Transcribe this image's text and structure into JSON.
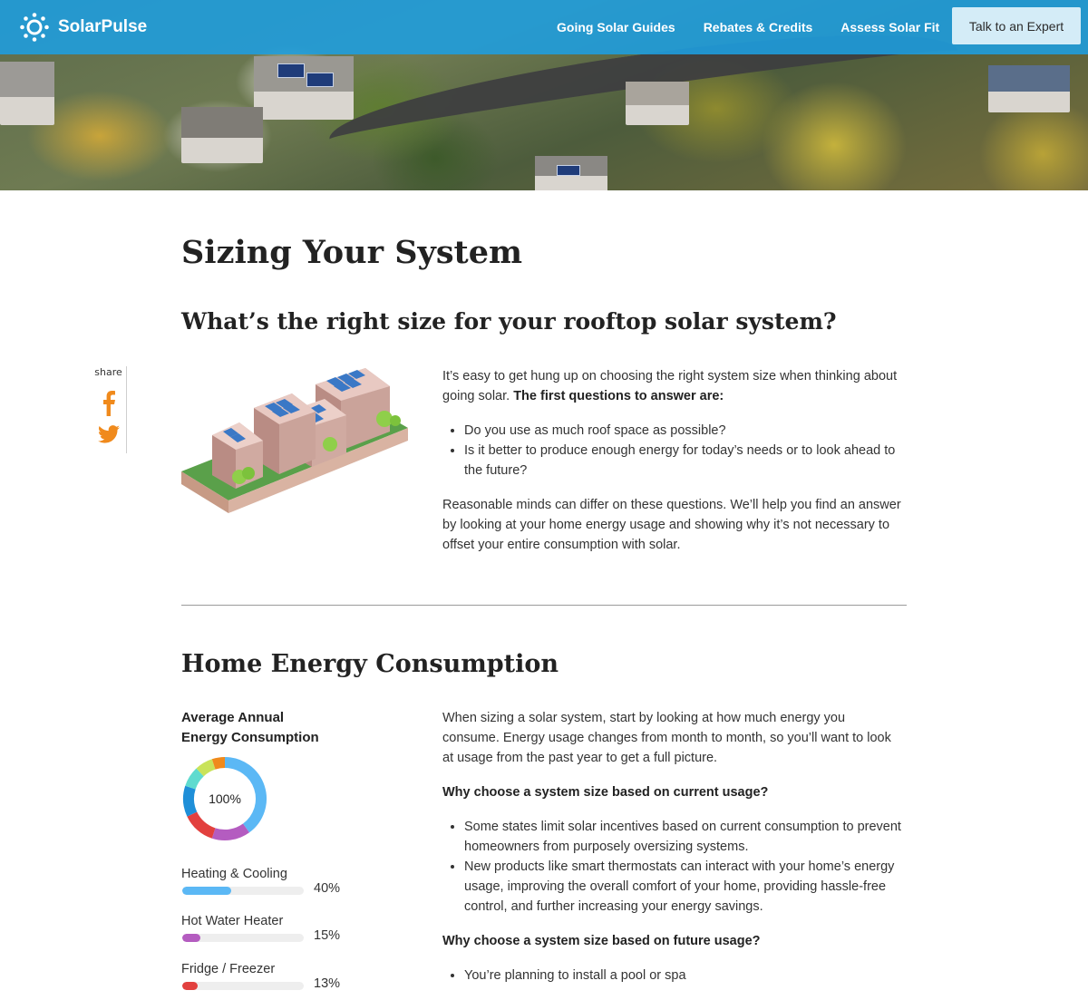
{
  "brand": {
    "name": "SolarPulse",
    "logo_icon": "sun-icon",
    "accent": "#1e9ee0"
  },
  "nav": {
    "links": [
      "Going Solar Guides",
      "Rebates & Credits",
      "Assess Solar Fit"
    ],
    "cta": "Talk to an Expert"
  },
  "page": {
    "title": "Sizing Your System",
    "subtitle": "What’s the right size for your rooftop solar system?"
  },
  "share": {
    "label": "share",
    "icons": [
      "facebook-icon",
      "twitter-icon"
    ],
    "color": "#f08a1c"
  },
  "intro": {
    "p1_text": "It’s easy to get hung up on choosing the right system size when thinking about going solar. ",
    "p1_bold": "The first questions to answer are:",
    "bullets": [
      "Do you use as much roof space as possible?",
      "Is it better to produce enough energy for today’s needs or to look ahead to the future?"
    ],
    "p2": "Reasonable minds can differ on these questions. We’ll help you find an answer by looking at your home energy usage and showing why it’s not necessary to offset your entire consumption with solar."
  },
  "consumption": {
    "title": "Home Energy Consumption",
    "chart_title_line1": "Average Annual",
    "chart_title_line2": "Energy Consumption",
    "donut_label": "100%",
    "p1": "When sizing a solar system, start by looking at how much energy you consume. Energy usage changes from month to month, so you’ll want to look at usage from the past year to get a full picture.",
    "q1": "Why choose a system size based on current usage?",
    "q1_bullets": [
      "Some states limit solar incentives based on current consumption to prevent homeowners from purposely oversizing systems.",
      "New products like smart thermostats can interact with your home’s energy usage, improving the overall comfort of your home, providing hassle-free control, and further increasing your energy savings."
    ],
    "q2": "Why choose a system size based on future usage?",
    "q2_bullets": [
      "You’re planning to install a pool or spa"
    ]
  },
  "chart_data": {
    "type": "pie",
    "title": "Average Annual Energy Consumption",
    "center_label": "100%",
    "series": [
      {
        "name": "Heating & Cooling",
        "value": 40,
        "label": "40%",
        "color": "#5bb8f5"
      },
      {
        "name": "Hot Water Heater",
        "value": 15,
        "label": "15%",
        "color": "#b45cc0"
      },
      {
        "name": "Fridge / Freezer",
        "value": 13,
        "label": "13%",
        "color": "#e2403e"
      },
      {
        "value": 12,
        "color": "#1f8fd8"
      },
      {
        "value": 8,
        "color": "#5fdbcf"
      },
      {
        "value": 7,
        "color": "#c9e35a"
      },
      {
        "value": 5,
        "color": "#f08a1c"
      }
    ]
  }
}
